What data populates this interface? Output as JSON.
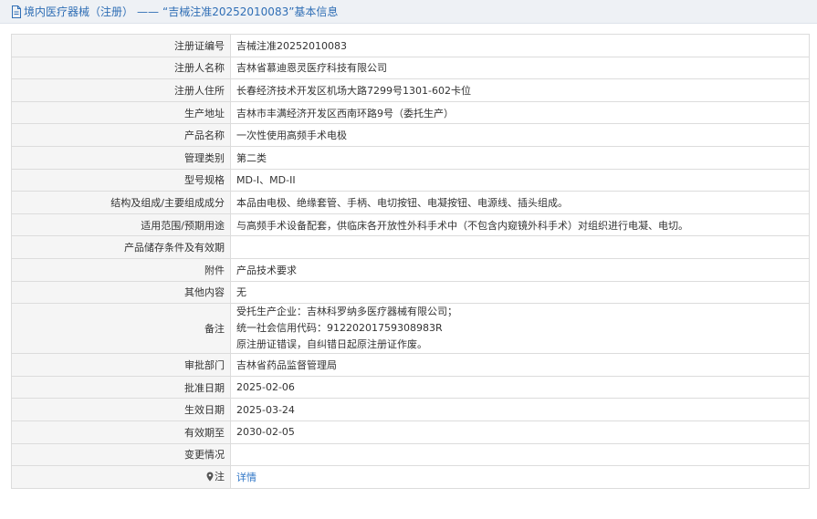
{
  "header": {
    "section": "境内医疗器械（注册）",
    "separator": "——",
    "title": "“吉械注准20252010083”基本信息"
  },
  "rows": [
    {
      "label": "注册证编号",
      "value": "吉械注准20252010083"
    },
    {
      "label": "注册人名称",
      "value": "吉林省慕迪恩灵医疗科技有限公司"
    },
    {
      "label": "注册人住所",
      "value": "长春经济技术开发区机场大路7299号1301-602卡位"
    },
    {
      "label": "生产地址",
      "value": "吉林市丰满经济开发区西南环路9号（委托生产）"
    },
    {
      "label": "产品名称",
      "value": "一次性使用高频手术电极"
    },
    {
      "label": "管理类别",
      "value": "第二类"
    },
    {
      "label": "型号规格",
      "value": "MD-I、MD-II"
    },
    {
      "label": "结构及组成/主要组成成分",
      "value": "本品由电极、绝缘套管、手柄、电切按钮、电凝按钮、电源线、插头组成。"
    },
    {
      "label": "适用范围/预期用途",
      "value": "与高频手术设备配套，供临床各开放性外科手术中（不包含内窥镜外科手术）对组织进行电凝、电切。"
    },
    {
      "label": "产品储存条件及有效期",
      "value": ""
    },
    {
      "label": "附件",
      "value": "产品技术要求"
    },
    {
      "label": "其他内容",
      "value": "无"
    }
  ],
  "remarks": {
    "label": "备注",
    "lines": [
      "受托生产企业：吉林科罗纳多医疗器械有限公司；",
      "统一社会信用代码：91220201759308983R",
      "原注册证错误，自纠错日起原注册证作废。"
    ]
  },
  "rows2": [
    {
      "label": "审批部门",
      "value": "吉林省药品监督管理局"
    },
    {
      "label": "批准日期",
      "value": "2025-02-06"
    },
    {
      "label": "生效日期",
      "value": "2025-03-24"
    },
    {
      "label": "有效期至",
      "value": "2030-02-05"
    },
    {
      "label": "变更情况",
      "value": ""
    }
  ],
  "note_row": {
    "icon": "pin-icon",
    "label": "注",
    "link": "详情"
  },
  "colors": {
    "link": "#2e75c6",
    "label_bg": "#f5f5f5",
    "border": "#dcdcdc"
  }
}
